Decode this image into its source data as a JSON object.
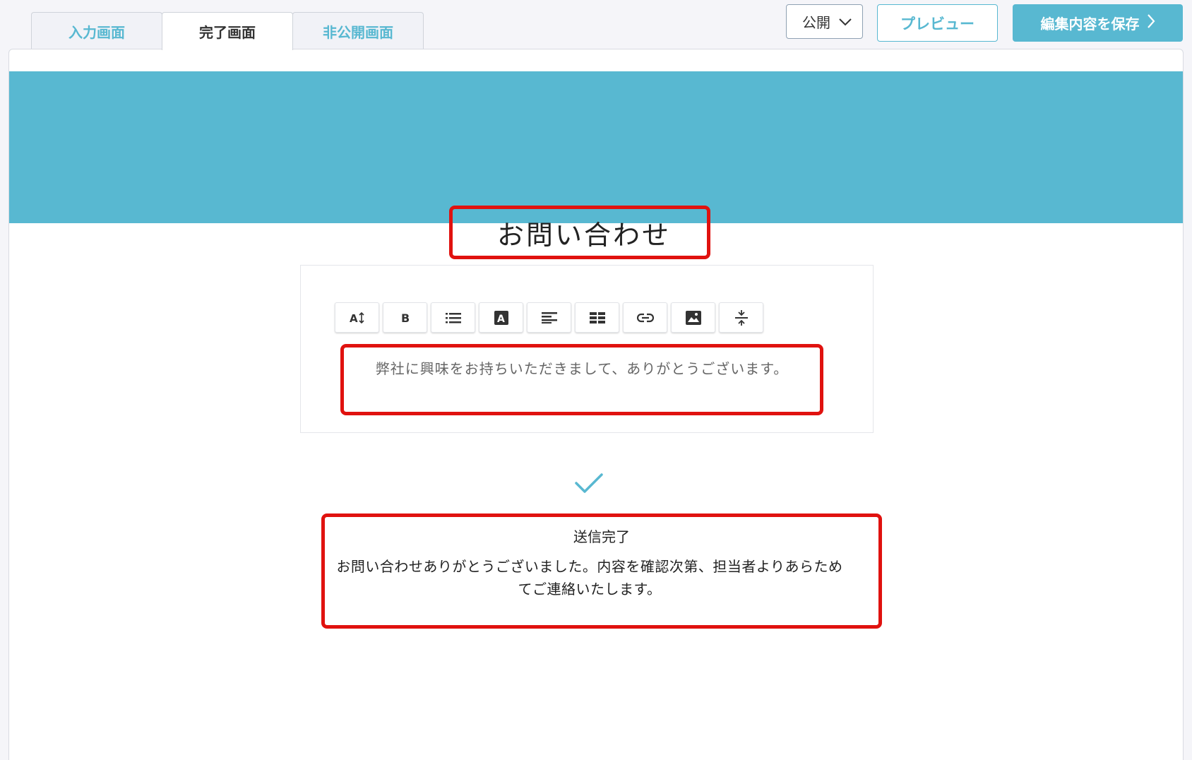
{
  "tabs": [
    {
      "label": "入力画面",
      "active": false
    },
    {
      "label": "完了画面",
      "active": true
    },
    {
      "label": "非公開画面",
      "active": false
    }
  ],
  "header": {
    "status_value": "公開",
    "preview_label": "プレビュー",
    "save_label": "編集内容を保存"
  },
  "page": {
    "title": "お問い合わせ",
    "editor_text": "弊社に興味をお持ちいただきまして、ありがとうございます。",
    "complete_title": "送信完了",
    "complete_message": "お問い合わせありがとうございました。内容を確認次第、担当者よりあらためてご連絡いたします。"
  },
  "toolbar": {
    "buttons": [
      "font-size-icon",
      "bold-icon",
      "list-icon",
      "text-color-icon",
      "align-icon",
      "table-icon",
      "link-icon",
      "image-icon",
      "divider-icon"
    ]
  },
  "colors": {
    "accent": "#58b8d1",
    "highlight": "#e0120f",
    "background": "#f5f5f9"
  }
}
